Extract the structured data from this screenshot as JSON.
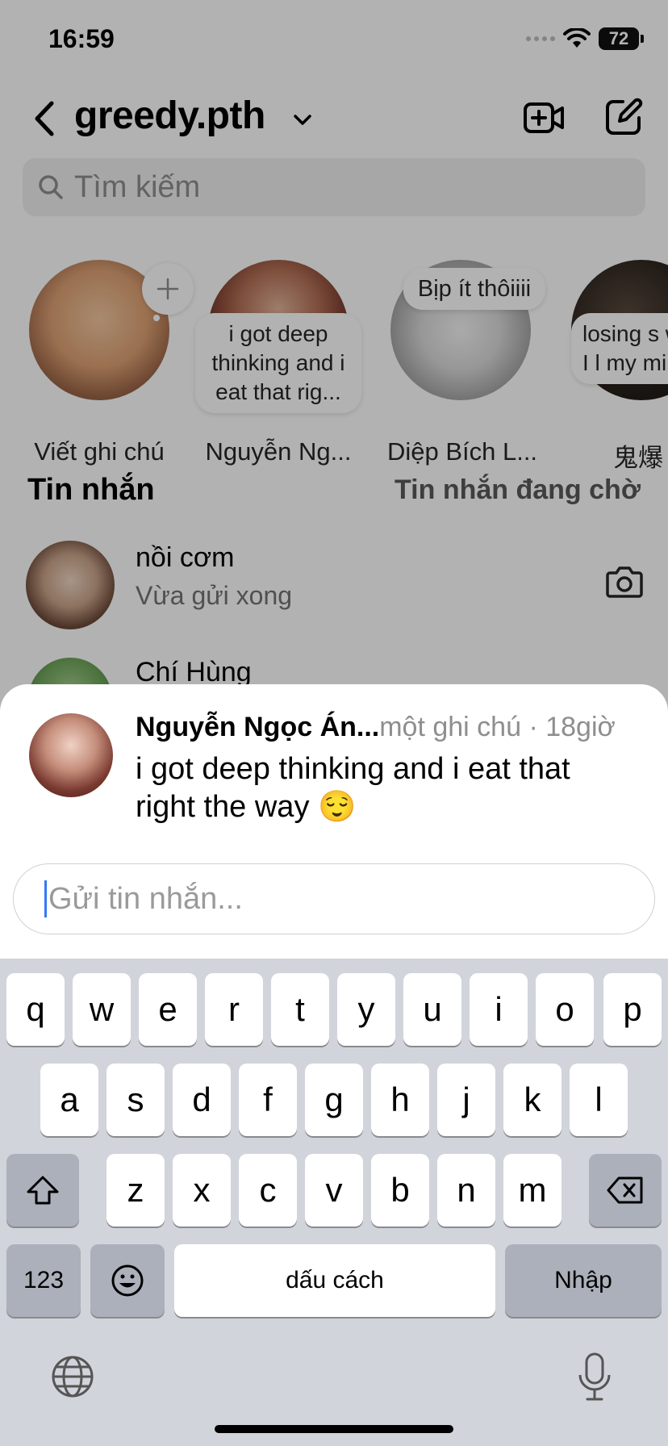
{
  "status_bar": {
    "time": "16:59",
    "battery": "72"
  },
  "header": {
    "account": "greedy.pth"
  },
  "search": {
    "placeholder": "Tìm kiếm"
  },
  "notes": [
    {
      "name": "Viết ghi chú",
      "note": ""
    },
    {
      "name": "Nguyễn Ng...",
      "note": "i got deep thinking and i eat that rig..."
    },
    {
      "name": "Diệp Bích L...",
      "note": "Bịp ít thôiiii"
    },
    {
      "name": "鬼爆",
      "note": "losing s while I l my min"
    }
  ],
  "messages": {
    "title": "Tin nhắn",
    "pending": "Tin nhắn đang chờ",
    "threads": [
      {
        "name": "nồi cơm",
        "sub": "Vừa gửi xong"
      },
      {
        "name": "Chí Hùng",
        "sub": ""
      }
    ]
  },
  "sheet": {
    "name": "Nguyễn Ngọc Án...",
    "meta": "một ghi chú · 18giờ",
    "note": "i got deep thinking and i eat that right the way 😌",
    "reply_placeholder": "Gửi tin nhắn..."
  },
  "keyboard": {
    "row1": [
      "q",
      "w",
      "e",
      "r",
      "t",
      "y",
      "u",
      "i",
      "o",
      "p"
    ],
    "row2": [
      "a",
      "s",
      "d",
      "f",
      "g",
      "h",
      "j",
      "k",
      "l"
    ],
    "row3": [
      "z",
      "x",
      "c",
      "v",
      "b",
      "n",
      "m"
    ],
    "numbers": "123",
    "space": "dấu cách",
    "return": "Nhập"
  },
  "colors": {
    "accent": "#3478f6",
    "keyboard_bg": "#d1d4db"
  }
}
